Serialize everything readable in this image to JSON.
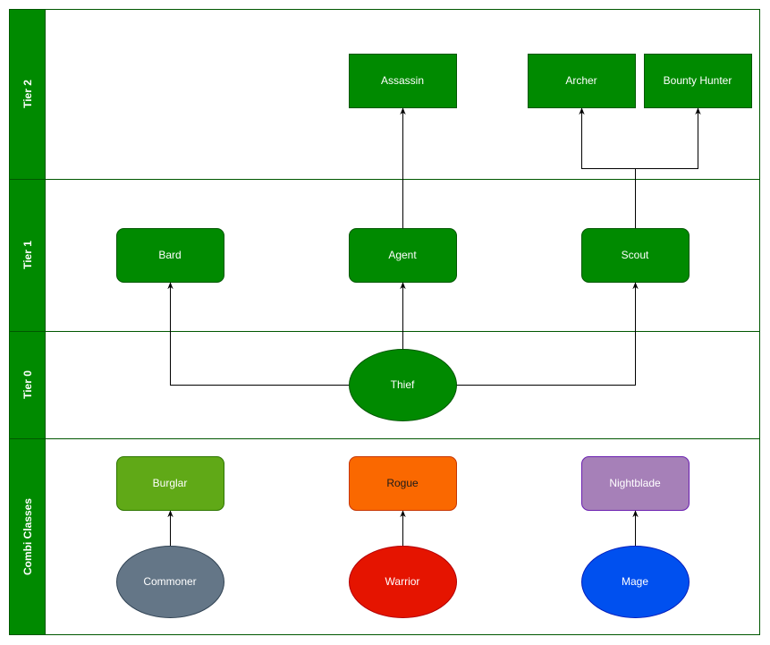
{
  "lanes": {
    "tier2": "Tier 2",
    "tier1": "Tier 1",
    "tier0": "Tier 0",
    "combi": "Combi Classes"
  },
  "nodes": {
    "assassin": "Assassin",
    "archer": "Archer",
    "bounty_hunter": "Bounty Hunter",
    "bard": "Bard",
    "agent": "Agent",
    "scout": "Scout",
    "thief": "Thief",
    "burglar": "Burglar",
    "rogue": "Rogue",
    "nightblade": "Nightblade",
    "commoner": "Commoner",
    "warrior": "Warrior",
    "mage": "Mage"
  },
  "colors": {
    "lane_header": "#008a00",
    "class_green": "#008a00",
    "burglar": "#60a917",
    "rogue": "#fa6800",
    "nightblade": "#a680b8",
    "commoner": "#647687",
    "warrior": "#e51400",
    "mage": "#0050ef"
  }
}
